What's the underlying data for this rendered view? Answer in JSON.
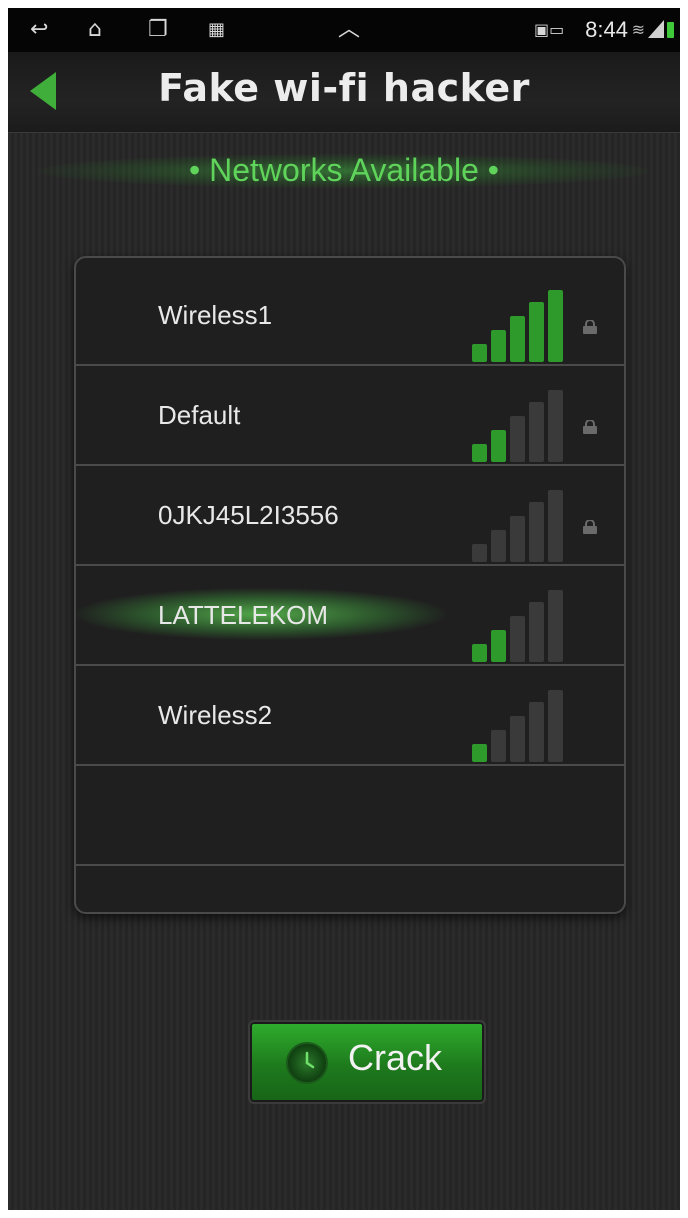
{
  "status_bar": {
    "time": "8:44",
    "icons": [
      "back-nav-icon",
      "home-icon",
      "recent-apps-icon",
      "screenshot-icon",
      "expand-up-icon",
      "notification-icon",
      "wifi-icon",
      "signal-icon",
      "battery-icon"
    ]
  },
  "header": {
    "title": "Fake wi-fi hacker",
    "back_icon": "back-arrow-icon"
  },
  "section": {
    "label": "• Networks Available •"
  },
  "networks": [
    {
      "name": "Wireless1",
      "signal_bars": 5,
      "locked": true,
      "highlighted": false
    },
    {
      "name": "Default",
      "signal_bars": 2,
      "locked": true,
      "highlighted": false
    },
    {
      "name": "0JKJ45L2I3556",
      "signal_bars": 0,
      "locked": true,
      "highlighted": false
    },
    {
      "name": "LATTELEKOM",
      "signal_bars": 2,
      "locked": false,
      "highlighted": true
    },
    {
      "name": "Wireless2",
      "signal_bars": 1,
      "locked": false,
      "highlighted": false
    }
  ],
  "crack_button": {
    "label": "Crack",
    "icon": "clock-icon"
  },
  "colors": {
    "accent_green": "#3fae3a",
    "signal_on": "#2f9a2c",
    "signal_off": "#3a3a3a",
    "panel_bg": "#1f1f1f"
  }
}
